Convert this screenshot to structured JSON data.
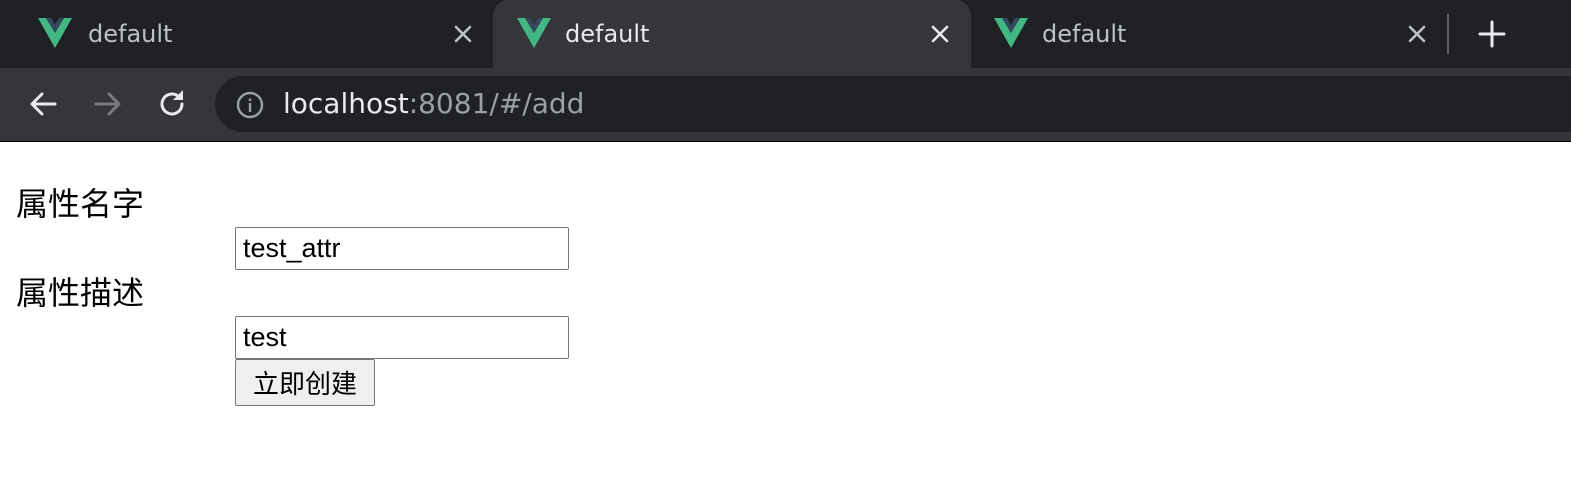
{
  "browser": {
    "tabs": [
      {
        "title": "default",
        "favicon": "vue-logo-icon",
        "active": false
      },
      {
        "title": "default",
        "favicon": "vue-logo-icon",
        "active": true
      },
      {
        "title": "default",
        "favicon": "vue-logo-icon",
        "active": false
      }
    ],
    "address": {
      "host": "localhost",
      "rest": ":8081/#/add"
    },
    "colors": {
      "vue_green": "#41b883",
      "vue_dark": "#35495e",
      "tabstrip_bg": "#202124",
      "toolbar_bg": "#35363a"
    }
  },
  "form": {
    "name_label": "属性名字",
    "name_value": "test_attr",
    "desc_label": "属性描述",
    "desc_value": "test",
    "submit_label": "立即创建"
  }
}
